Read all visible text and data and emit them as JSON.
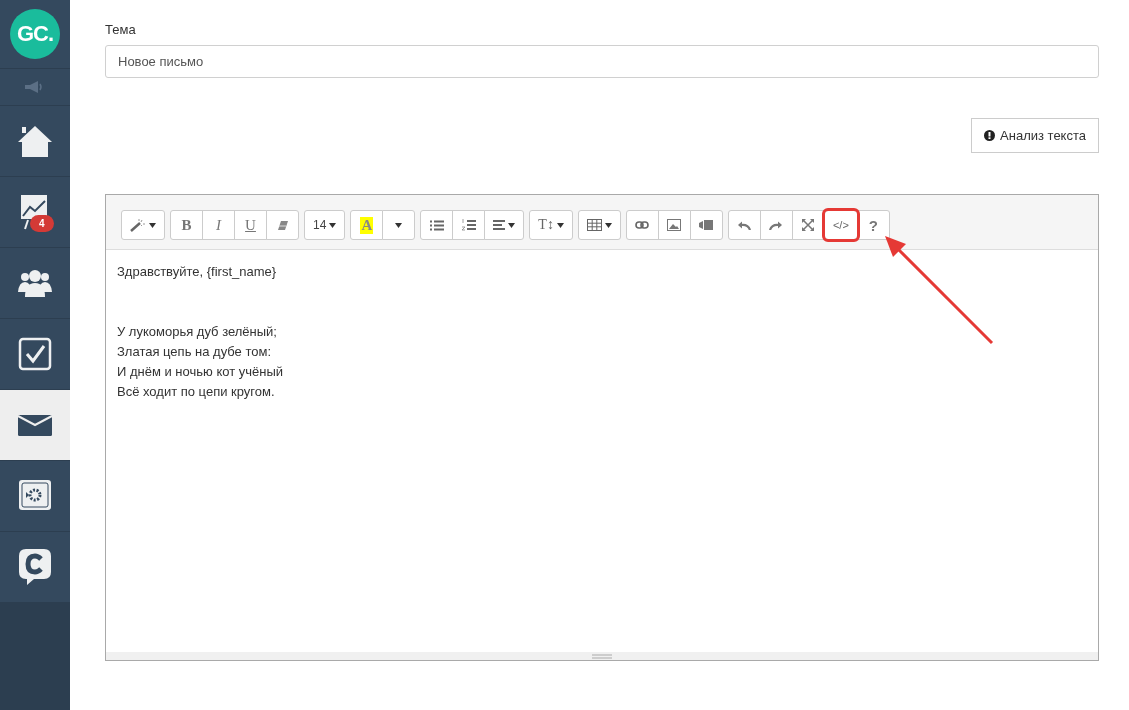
{
  "sidebar": {
    "logo": "GC.",
    "items": [
      {
        "selected": false
      },
      {
        "selected": false
      },
      {
        "selected": false,
        "badge": "4"
      },
      {
        "selected": false
      },
      {
        "selected": false
      },
      {
        "selected": true
      },
      {
        "selected": false
      },
      {
        "selected": false
      }
    ]
  },
  "subject": {
    "label": "Тема",
    "value": "Новое письмо"
  },
  "analyze_button": "Анализ текста",
  "toolbar_labels": [
    {
      "label": "B",
      "highlighted": false
    },
    {
      "label": "I",
      "highlighted": false
    },
    {
      "label": "U",
      "highlighted": false
    },
    {
      "label": "14",
      "highlighted": false
    },
    {
      "label": "A",
      "highlighted": false
    },
    {
      "label": "T↕",
      "highlighted": false
    },
    {
      "label": "</>",
      "highlighted": true
    },
    {
      "label": "?",
      "highlighted": false
    }
  ],
  "greeting": "Здравствуйте, {first_name}",
  "poem": [
    "У лукоморья дуб зелёный;",
    "Златая цепь на дубе том:",
    "И днём и ночью кот учёный",
    "Всё ходит по цепи кругом."
  ]
}
